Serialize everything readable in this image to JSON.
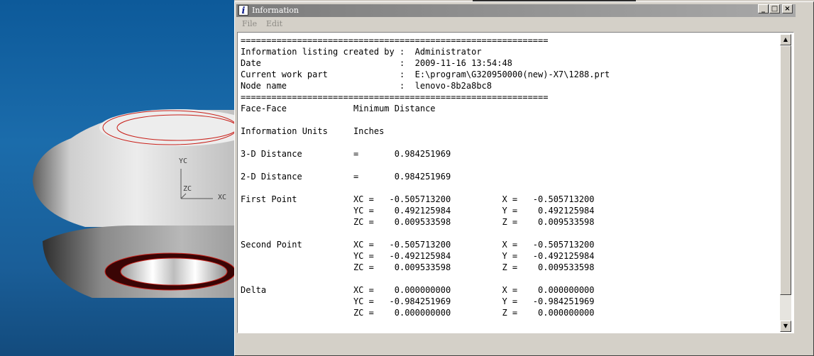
{
  "window": {
    "title": "Information",
    "title_icon": "i",
    "minimize_glyph": "_",
    "maximize_glyph": "□",
    "close_glyph": "×"
  },
  "menu": {
    "file": "File",
    "edit": "Edit"
  },
  "viewport": {
    "axis_labels": {
      "yc": "YC",
      "zc": "ZC",
      "xc": "XC"
    },
    "colors": {
      "background": "#1a63a3",
      "edges": "#c8201a"
    }
  },
  "scrollbar": {
    "up_glyph": "▲",
    "down_glyph": "▼"
  },
  "listing": {
    "lines": [
      "============================================================",
      "Information listing created by :  Administrator",
      "Date                           :  2009-11-16 13:54:48",
      "Current work part              :  E:\\program\\G320950000(new)-X7\\1288.prt",
      "Node name                      :  lenovo-8b2a8bc8",
      "============================================================",
      "Face-Face             Minimum Distance",
      "",
      "Information Units     Inches",
      "",
      "3-D Distance          =       0.984251969",
      "",
      "2-D Distance          =       0.984251969",
      "",
      "First Point           XC =   -0.505713200          X =   -0.505713200",
      "                      YC =    0.492125984          Y =    0.492125984",
      "                      ZC =    0.009533598          Z =    0.009533598",
      "",
      "Second Point          XC =   -0.505713200          X =   -0.505713200",
      "                      YC =   -0.492125984          Y =   -0.492125984",
      "                      ZC =    0.009533598          Z =    0.009533598",
      "",
      "Delta                 XC =    0.000000000          X =    0.000000000",
      "                      YC =   -0.984251969          Y =   -0.984251969",
      "                      ZC =    0.000000000          Z =    0.000000000"
    ]
  }
}
